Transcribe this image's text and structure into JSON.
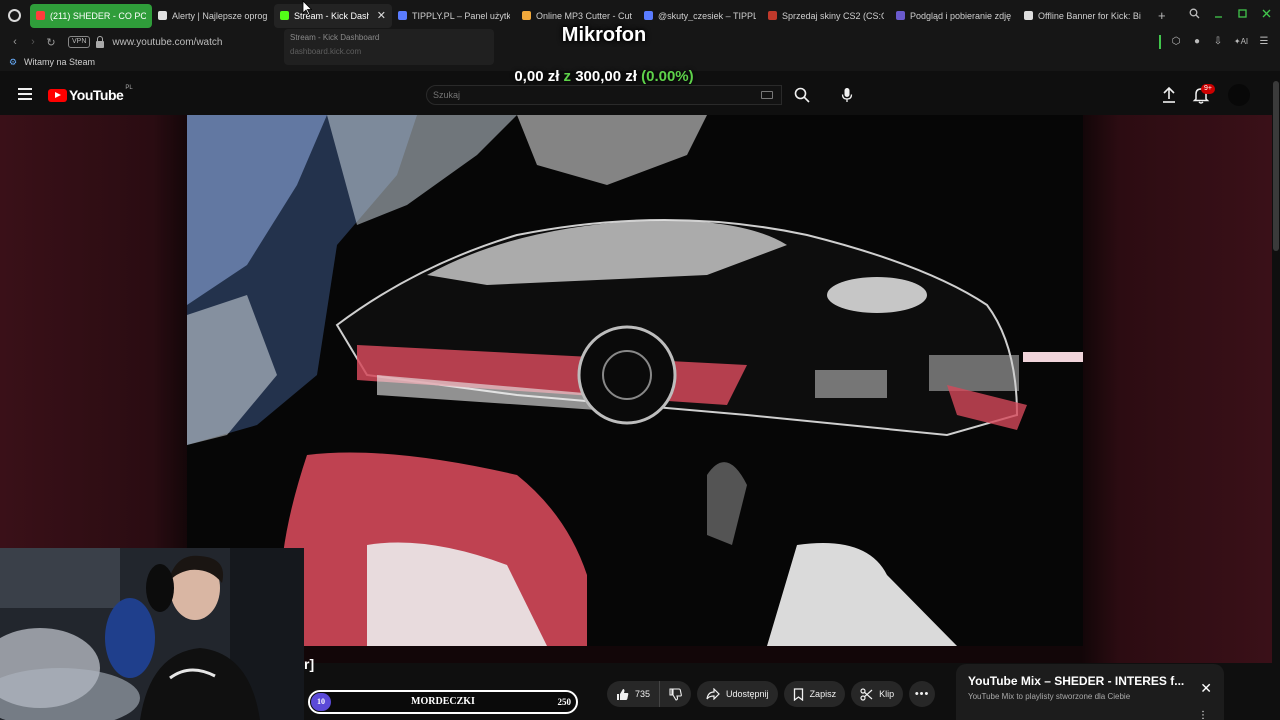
{
  "browser": {
    "tabs": [
      {
        "label": "(211) SHEDER - CO PO",
        "color": "#ff3b3b",
        "state": "green"
      },
      {
        "label": "Alerty | Najlepsze oprogr",
        "color": "#e0e0e0",
        "state": "normal"
      },
      {
        "label": "Stream - Kick Dashbo",
        "color": "#53fc18",
        "state": "active",
        "close": "✕"
      },
      {
        "label": "TIPPLY.PL – Panel użytko",
        "color": "#5a7cff",
        "state": "normal"
      },
      {
        "label": "Online MP3 Cutter - Cut S",
        "color": "#f2a93b",
        "state": "normal"
      },
      {
        "label": "@skuty_czesiek – TIPPLY",
        "color": "#5a7cff",
        "state": "normal"
      },
      {
        "label": "Sprzedaj skiny CS2 (CS:G",
        "color": "#c0392b",
        "state": "normal"
      },
      {
        "label": "Podgląd i pobieranie zdję",
        "color": "#6a5acd",
        "state": "normal"
      },
      {
        "label": "Offline Banner for Kick: Bi",
        "color": "#dddddd",
        "state": "normal"
      }
    ],
    "new_tab": "+",
    "vpn_label": "VPN",
    "url": "www.youtube.com/watch",
    "bookmark": "Witamy na Steam",
    "tooltip": {
      "title": "Stream - Kick Dashboard",
      "url": "dashboard.kick.com"
    }
  },
  "overlay": {
    "title": "Mikrofon",
    "goal_current": "0,00 zł",
    "goal_sep": "z",
    "goal_target": "300,00 zł",
    "goal_percent": "(0.00%)"
  },
  "youtube": {
    "logo": "YouTube",
    "country": "PL",
    "search_placeholder": "Szukaj",
    "notifications": "9+"
  },
  "video": {
    "caption_fragment": "r]"
  },
  "song_bar": {
    "start": "10",
    "title": "MORDECZKI",
    "end": "250",
    "progress": 0.0
  },
  "actions": {
    "likes": "735",
    "share": "Udostępnij",
    "save": "Zapisz",
    "clip": "Klip"
  },
  "mix": {
    "title": "YouTube Mix – SHEDER - INTERES f...",
    "subtitle": "YouTube Mix to playlisty stworzone dla Ciebie"
  },
  "colors": {
    "accent_green": "#41c64c",
    "goal_green": "#5ed24a",
    "yt_red": "#ff0000",
    "progress_purple": "#5b4ad8"
  }
}
